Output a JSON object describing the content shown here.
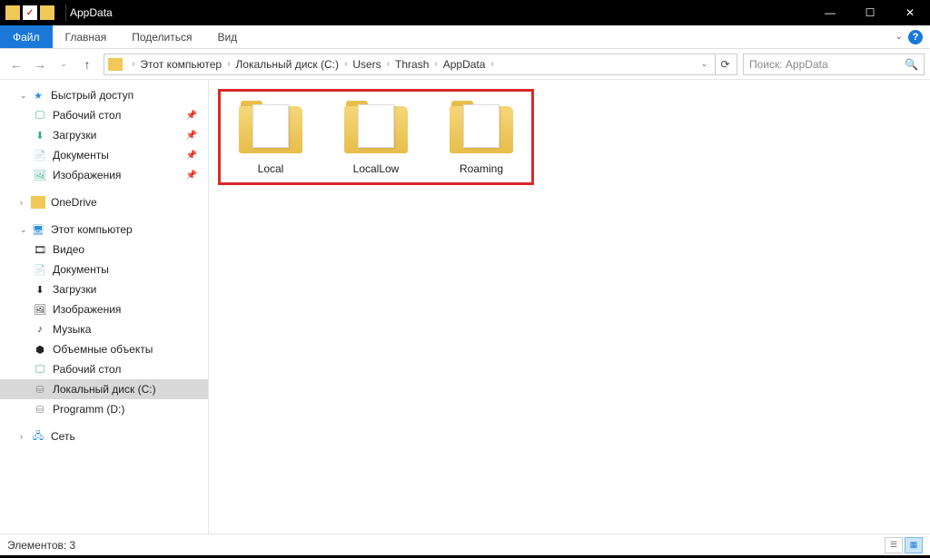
{
  "title": "AppData",
  "ribbon": {
    "file": "Файл",
    "tabs": [
      "Главная",
      "Поделиться",
      "Вид"
    ]
  },
  "breadcrumb": [
    "Этот компьютер",
    "Локальный диск (C:)",
    "Users",
    "Thrash",
    "AppData"
  ],
  "search_placeholder": "Поиск: AppData",
  "sidebar": {
    "quick": "Быстрый доступ",
    "quick_items": [
      {
        "label": "Рабочий стол",
        "icon": "desktop"
      },
      {
        "label": "Загрузки",
        "icon": "downloads"
      },
      {
        "label": "Документы",
        "icon": "docs"
      },
      {
        "label": "Изображения",
        "icon": "pics"
      }
    ],
    "onedrive": "OneDrive",
    "thispc": "Этот компьютер",
    "pc_items": [
      {
        "label": "Видео",
        "icon": "video"
      },
      {
        "label": "Документы",
        "icon": "docs"
      },
      {
        "label": "Загрузки",
        "icon": "downloads"
      },
      {
        "label": "Изображения",
        "icon": "pics"
      },
      {
        "label": "Музыка",
        "icon": "music"
      },
      {
        "label": "Объемные объекты",
        "icon": "3d"
      },
      {
        "label": "Рабочий стол",
        "icon": "desktop"
      },
      {
        "label": "Локальный диск (C:)",
        "icon": "disk",
        "selected": true
      },
      {
        "label": "Programm (D:)",
        "icon": "disk"
      }
    ],
    "network": "Сеть"
  },
  "folders": [
    "Local",
    "LocalLow",
    "Roaming"
  ],
  "status": "Элементов: 3"
}
